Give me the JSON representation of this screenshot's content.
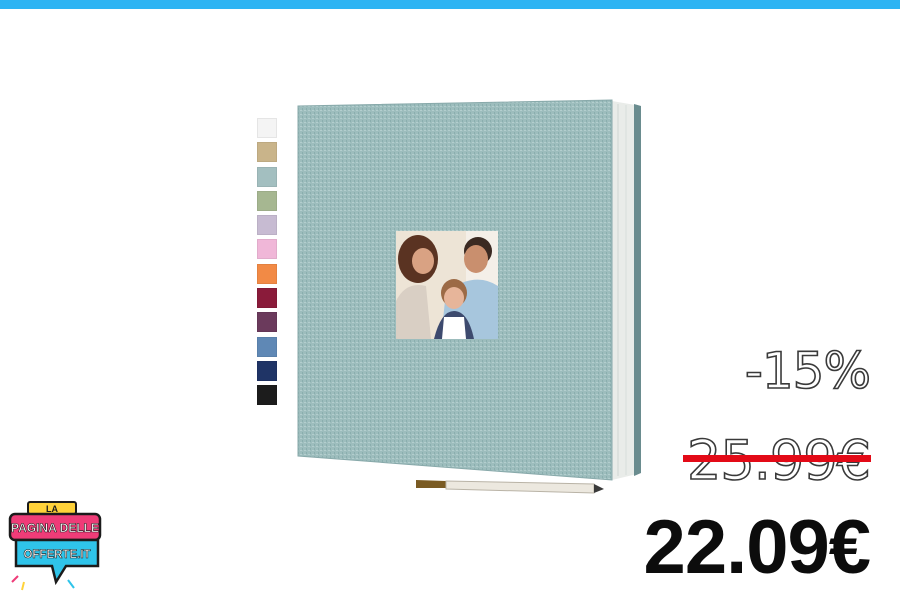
{
  "colors": {
    "accent_bar": "#2eb4f3",
    "album_cover": "#9dbdbd",
    "old_price_strike": "#e30a17"
  },
  "product": {
    "swatches": [
      {
        "name": "white",
        "color": "#f4f4f4"
      },
      {
        "name": "beige",
        "color": "#c9b48a"
      },
      {
        "name": "light-blue",
        "color": "#a3bfc0"
      },
      {
        "name": "sage-green",
        "color": "#a6b791"
      },
      {
        "name": "lavender",
        "color": "#c7bbd2"
      },
      {
        "name": "pink",
        "color": "#f0b7d8"
      },
      {
        "name": "orange",
        "color": "#f28a45"
      },
      {
        "name": "burgundy",
        "color": "#8a1b3a"
      },
      {
        "name": "plum",
        "color": "#6b3a5c"
      },
      {
        "name": "denim-blue",
        "color": "#5f88b5"
      },
      {
        "name": "navy",
        "color": "#1f3466"
      },
      {
        "name": "black",
        "color": "#1c1c1c"
      }
    ]
  },
  "pricing": {
    "discount": "-15%",
    "old_price": "25.99€",
    "new_price": "22.09€"
  },
  "logo": {
    "line1": "LA",
    "line2": "PAGINA DELLE",
    "line3": "OFFERTE.IT"
  }
}
